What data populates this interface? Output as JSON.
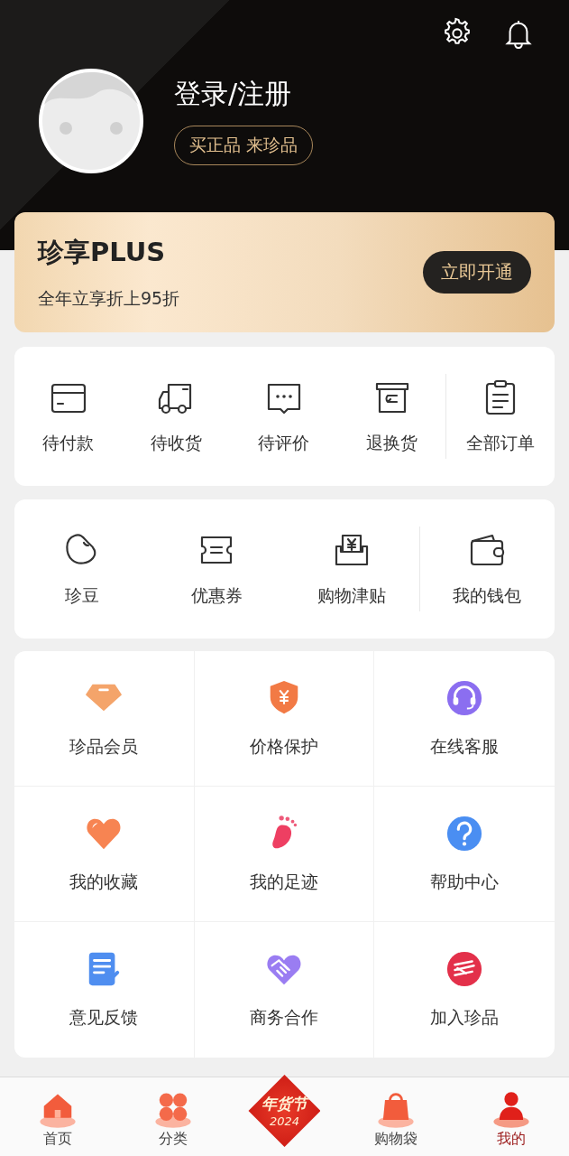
{
  "header": {
    "login_label": "登录/注册",
    "slogan": "买正品 来珍品"
  },
  "plus_card": {
    "title": "珍享PLUS",
    "subtitle": "全年立享折上95折",
    "button": "立即开通"
  },
  "orders": [
    {
      "label": "待付款"
    },
    {
      "label": "待收货"
    },
    {
      "label": "待评价"
    },
    {
      "label": "退换货"
    },
    {
      "label": "全部订单"
    }
  ],
  "wallet": [
    {
      "label": "珍豆"
    },
    {
      "label": "优惠券"
    },
    {
      "label": "购物津贴"
    },
    {
      "label": "我的钱包"
    }
  ],
  "services": [
    {
      "label": "珍品会员"
    },
    {
      "label": "价格保护"
    },
    {
      "label": "在线客服"
    },
    {
      "label": "我的收藏"
    },
    {
      "label": "我的足迹"
    },
    {
      "label": "帮助中心"
    },
    {
      "label": "意见反馈"
    },
    {
      "label": "商务合作"
    },
    {
      "label": "加入珍品"
    }
  ],
  "festival_badge": {
    "title": "年货节",
    "year": "2024"
  },
  "tab_bar": [
    {
      "label": "首页",
      "selected": false
    },
    {
      "label": "分类",
      "selected": false
    },
    {
      "label": "购物袋",
      "selected": false
    },
    {
      "label": "我的",
      "selected": true
    }
  ]
}
